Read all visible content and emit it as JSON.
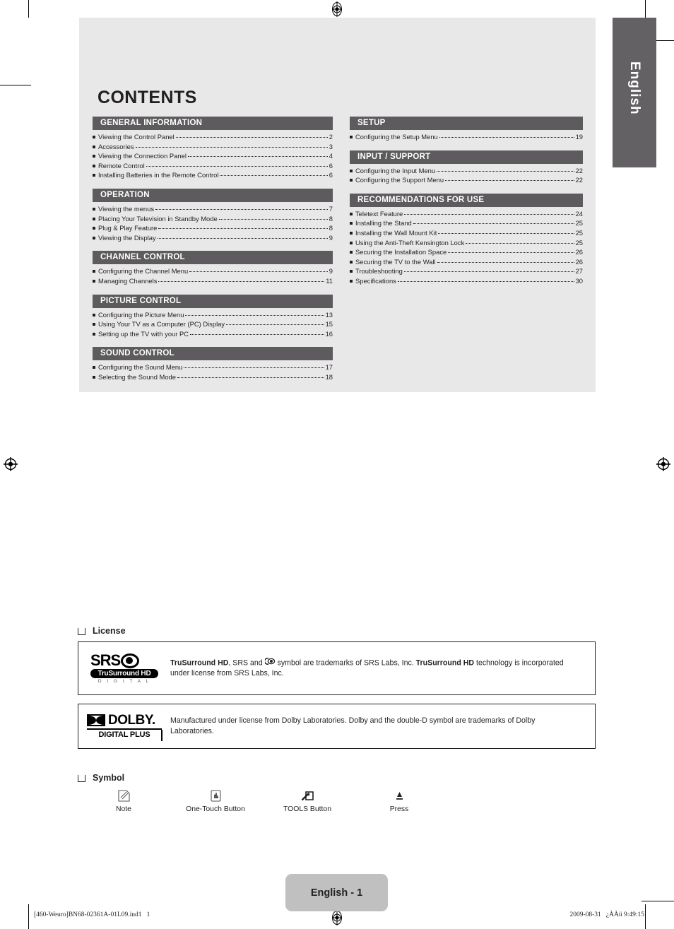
{
  "language_tab": "English",
  "page_title": "CONTENTS",
  "toc": {
    "left_column": [
      {
        "heading": "GENERAL INFORMATION",
        "items": [
          {
            "label": "Viewing the Control Panel",
            "page": "2"
          },
          {
            "label": "Accessories",
            "page": "3"
          },
          {
            "label": "Viewing the Connection Panel",
            "page": "4"
          },
          {
            "label": "Remote Control",
            "page": "6"
          },
          {
            "label": "Installing Batteries in the Remote Control",
            "page": "6"
          }
        ]
      },
      {
        "heading": "OPERATION",
        "items": [
          {
            "label": "Viewing the menus",
            "page": "7"
          },
          {
            "label": "Placing Your Television in Standby Mode",
            "page": "8"
          },
          {
            "label": "Plug & Play Feature",
            "page": "8"
          },
          {
            "label": "Viewing the Display",
            "page": "9"
          }
        ]
      },
      {
        "heading": "CHANNEL CONTROL",
        "items": [
          {
            "label": "Configuring the Channel Menu",
            "page": "9"
          },
          {
            "label": "Managing Channels",
            "page": "11"
          }
        ]
      },
      {
        "heading": "PICTURE CONTROL",
        "items": [
          {
            "label": "Configuring the Picture Menu",
            "page": "13"
          },
          {
            "label": "Using Your TV as a Computer (PC) Display",
            "page": "15"
          },
          {
            "label": "Setting up the TV with your PC",
            "page": "16"
          }
        ]
      },
      {
        "heading": "SOUND CONTROL",
        "items": [
          {
            "label": "Configuring the Sound Menu",
            "page": "17"
          },
          {
            "label": "Selecting the Sound Mode",
            "page": "18"
          }
        ]
      }
    ],
    "right_column": [
      {
        "heading": "SETUP",
        "items": [
          {
            "label": "Configuring the Setup Menu",
            "page": "19"
          }
        ]
      },
      {
        "heading": "INPUT / SUPPORT",
        "items": [
          {
            "label": "Configuring the Input Menu",
            "page": "22"
          },
          {
            "label": "Configuring the Support Menu",
            "page": "22"
          }
        ]
      },
      {
        "heading": "RECOMMENDATIONS FOR USE",
        "items": [
          {
            "label": "Teletext Feature",
            "page": "24"
          },
          {
            "label": "Installing the Stand",
            "page": "25"
          },
          {
            "label": "Installing the Wall Mount Kit",
            "page": "25"
          },
          {
            "label": "Using the Anti-Theft Kensington Lock",
            "page": "25"
          },
          {
            "label": "Securing the Installation Space",
            "page": "26"
          },
          {
            "label": "Securing the TV to the Wall",
            "page": "26"
          },
          {
            "label": "Troubleshooting",
            "page": "27"
          },
          {
            "label": "Specifications",
            "page": "30"
          }
        ]
      }
    ]
  },
  "license": {
    "heading": "License",
    "srs": {
      "logo_word": "SRS",
      "logo_band": "TruSurround HD",
      "logo_sub": "D I G I T A L",
      "text_part1": "TruSurround HD",
      "text_part2": ", SRS and ",
      "text_part3": " symbol are trademarks of SRS Labs, Inc. ",
      "text_part4": "TruSurround HD",
      "text_part5": " technology is incorporated under license from SRS Labs, Inc."
    },
    "dolby": {
      "logo_word": "DOLBY.",
      "logo_sub": "DIGITAL PLUS",
      "text": "Manufactured under license from Dolby Laboratories. Dolby and the double-D symbol are trademarks of Dolby Laboratories."
    }
  },
  "symbol": {
    "heading": "Symbol",
    "items": [
      {
        "icon": "note-icon",
        "label": "Note"
      },
      {
        "icon": "one-touch-button-icon",
        "label": "One-Touch Button"
      },
      {
        "icon": "tools-button-icon",
        "label": "TOOLS Button"
      },
      {
        "icon": "press-icon",
        "label": "Press"
      }
    ]
  },
  "footer": {
    "page_badge": "English - 1",
    "left": "[460-Weuro]BN68-02361A-01L09.ind1   1",
    "right": "2009-08-31   ¿ÀÀü 9:49:15"
  },
  "colors": {
    "panel_bg": "#e8e8e8",
    "section_header": "#5d5b5d",
    "lang_tab": "#636163",
    "badge": "#c0c0c0"
  }
}
